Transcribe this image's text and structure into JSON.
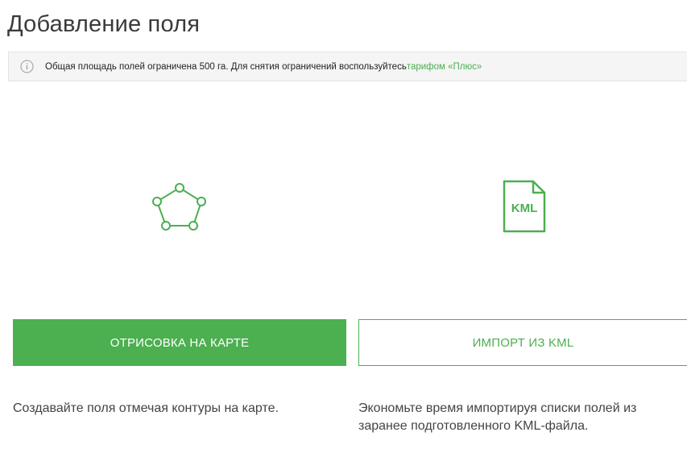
{
  "page": {
    "title": "Добавление поля"
  },
  "notice": {
    "icon": "info-icon",
    "text": "Общая площадь полей ограничена 500 га. Для снятия ограничений воспользуйтесь ",
    "link_text": "тарифом «Плюс»",
    "link_color": "#4caf50"
  },
  "options": {
    "draw": {
      "icon": "polygon-icon",
      "button_label": "ОТРИСОВКА НА КАРТЕ",
      "description": "Создавайте поля отмечая контуры на карте."
    },
    "import": {
      "icon": "kml-file-icon",
      "icon_text": "KML",
      "button_label": "ИМПОРТ ИЗ KML",
      "description": "Экономьте время импортируя списки полей из заранее подготовленного KML-файла."
    }
  },
  "colors": {
    "accent": "#4caf50",
    "notice_bg": "#f5f5f5",
    "text": "#444444"
  }
}
